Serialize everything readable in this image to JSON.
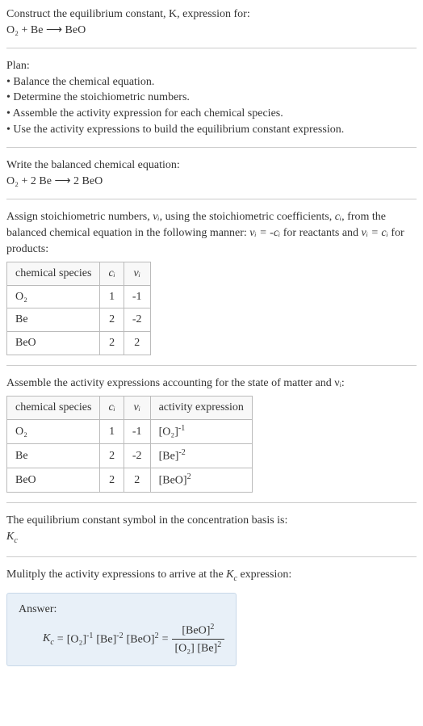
{
  "prompt": {
    "line1": "Construct the equilibrium constant, K, expression for:",
    "equation_lhs": "O₂ + Be",
    "arrow": "⟶",
    "equation_rhs": "BeO"
  },
  "plan": {
    "heading": "Plan:",
    "b1": "• Balance the chemical equation.",
    "b2": "• Determine the stoichiometric numbers.",
    "b3": "• Assemble the activity expression for each chemical species.",
    "b4": "• Use the activity expressions to build the equilibrium constant expression."
  },
  "balanced": {
    "heading": "Write the balanced chemical equation:",
    "lhs": "O₂ + 2 Be",
    "arrow": "⟶",
    "rhs": "2 BeO"
  },
  "stoich": {
    "text_part1": "Assign stoichiometric numbers, ",
    "nu": "νᵢ",
    "text_part2": ", using the stoichiometric coefficients, ",
    "ci": "cᵢ",
    "text_part3": ", from the balanced chemical equation in the following manner: ",
    "rel1": "νᵢ = -cᵢ",
    "text_part4": " for reactants and ",
    "rel2": "νᵢ = cᵢ",
    "text_part5": " for products:",
    "table": {
      "h1": "chemical species",
      "h2": "cᵢ",
      "h3": "νᵢ",
      "rows": [
        {
          "sp": "O₂",
          "c": "1",
          "v": "-1"
        },
        {
          "sp": "Be",
          "c": "2",
          "v": "-2"
        },
        {
          "sp": "BeO",
          "c": "2",
          "v": "2"
        }
      ]
    }
  },
  "activity": {
    "heading": "Assemble the activity expressions accounting for the state of matter and νᵢ:",
    "h1": "chemical species",
    "h2": "cᵢ",
    "h3": "νᵢ",
    "h4": "activity expression",
    "rows": [
      {
        "sp": "O₂",
        "c": "1",
        "v": "-1",
        "a_base": "[O₂]",
        "a_exp": "-1"
      },
      {
        "sp": "Be",
        "c": "2",
        "v": "-2",
        "a_base": "[Be]",
        "a_exp": "-2"
      },
      {
        "sp": "BeO",
        "c": "2",
        "v": "2",
        "a_base": "[BeO]",
        "a_exp": "2"
      }
    ]
  },
  "symbol": {
    "line1": "The equilibrium constant symbol in the concentration basis is:",
    "kc": "K",
    "kc_sub": "c"
  },
  "multiply": {
    "line": "Mulitply the activity expressions to arrive at the ",
    "kc": "K",
    "kc_sub": "c",
    "line2": " expression:"
  },
  "answer": {
    "label": "Answer:",
    "kc": "K",
    "kc_sub": "c",
    "eq": " = ",
    "t1_base": "[O₂]",
    "t1_exp": "-1",
    "t2_base": "[Be]",
    "t2_exp": "-2",
    "t3_base": "[BeO]",
    "t3_exp": "2",
    "eq2": " = ",
    "num_base": "[BeO]",
    "num_exp": "2",
    "den_t1": "[O₂]",
    "den_t2_base": "[Be]",
    "den_t2_exp": "2"
  }
}
